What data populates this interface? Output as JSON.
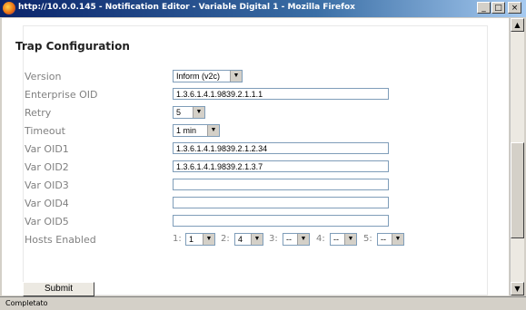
{
  "window": {
    "title": "http://10.0.0.145 - Notification Editor - Variable Digital 1 - Mozilla Firefox",
    "buttons": {
      "minimize": "_",
      "maximize": "□",
      "close": "×"
    }
  },
  "form": {
    "heading": "Trap Configuration",
    "labels": {
      "version": "Version",
      "enterprise_oid": "Enterprise OID",
      "retry": "Retry",
      "timeout": "Timeout",
      "var_oid1": "Var OID1",
      "var_oid2": "Var OID2",
      "var_oid3": "Var OID3",
      "var_oid4": "Var OID4",
      "var_oid5": "Var OID5",
      "hosts_enabled": "Hosts Enabled"
    },
    "values": {
      "version": "Inform (v2c)",
      "enterprise_oid": "1.3.6.1.4.1.9839.2.1.1.1",
      "retry": "5",
      "timeout": "1 min",
      "var_oid1": "1.3.6.1.4.1.9839.2.1.2.34",
      "var_oid2": "1.3.6.1.4.1.9839.2.1.3.7",
      "var_oid3": "",
      "var_oid4": "",
      "var_oid5": ""
    },
    "hosts": [
      {
        "label": "1:",
        "value": "1"
      },
      {
        "label": "2:",
        "value": "4"
      },
      {
        "label": "3:",
        "value": "--"
      },
      {
        "label": "4:",
        "value": "--"
      },
      {
        "label": "5:",
        "value": "--"
      }
    ],
    "submit_label": "Submit"
  },
  "status": {
    "text": "Completato"
  }
}
